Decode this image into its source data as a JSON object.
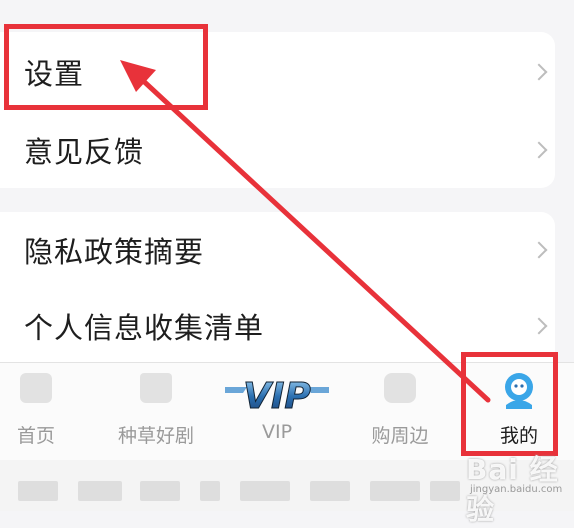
{
  "settings_card": {
    "items": [
      {
        "label": "设置"
      },
      {
        "label": "意见反馈"
      }
    ]
  },
  "privacy_card": {
    "items": [
      {
        "label": "隐私政策摘要"
      },
      {
        "label": "个人信息收集清单"
      }
    ]
  },
  "tabbar": {
    "tabs": [
      {
        "label": "首页",
        "icon": "home-icon"
      },
      {
        "label": "种草好剧",
        "icon": "shirt-icon"
      },
      {
        "label": "VIP",
        "icon": "vip-logo-icon"
      },
      {
        "label": "购周边",
        "icon": "bag-icon"
      },
      {
        "label": "我的",
        "icon": "profile-avatar-icon"
      }
    ],
    "selected": "我的"
  },
  "watermark": {
    "brand": "Bai 经验",
    "url": "jingyan.baidu.com"
  },
  "colors": {
    "annotation_red": "#e8323a",
    "accent_blue": "#3aa6e8",
    "vip_blue": "#2b6fb0"
  }
}
